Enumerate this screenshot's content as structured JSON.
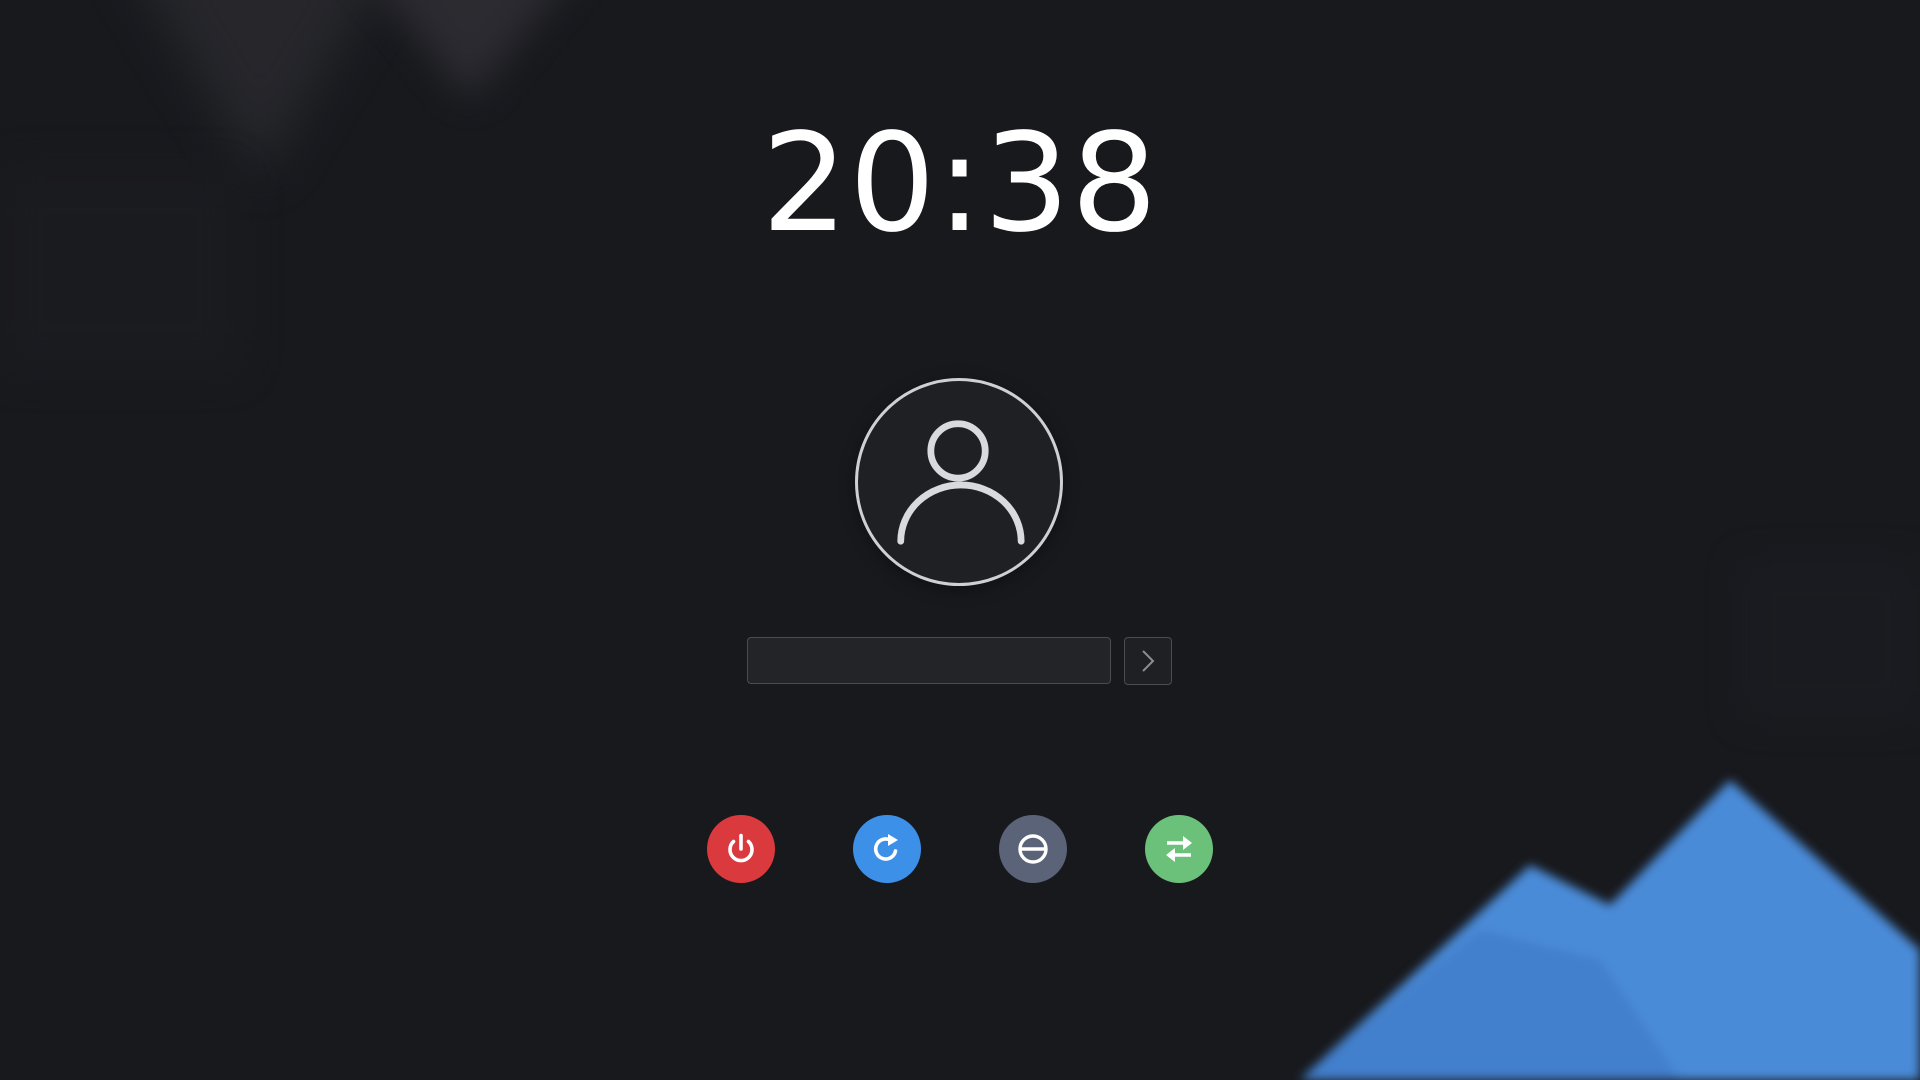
{
  "clock": {
    "time": "20:38"
  },
  "login": {
    "avatar_icon": "user-avatar-icon",
    "password_value": "",
    "password_placeholder": "",
    "submit_icon": "chevron-right-icon"
  },
  "actions": {
    "shutdown": {
      "icon": "power-icon",
      "color": "#da3a3d"
    },
    "reboot": {
      "icon": "refresh-icon",
      "color": "#3d90e8"
    },
    "suspend": {
      "icon": "block-icon",
      "color": "#5a6377"
    },
    "switch_user": {
      "icon": "swap-arrows-icon",
      "color": "#6cc17a"
    }
  },
  "theme": {
    "background": "#18191d",
    "accent_blue": "#4b8bd9"
  }
}
